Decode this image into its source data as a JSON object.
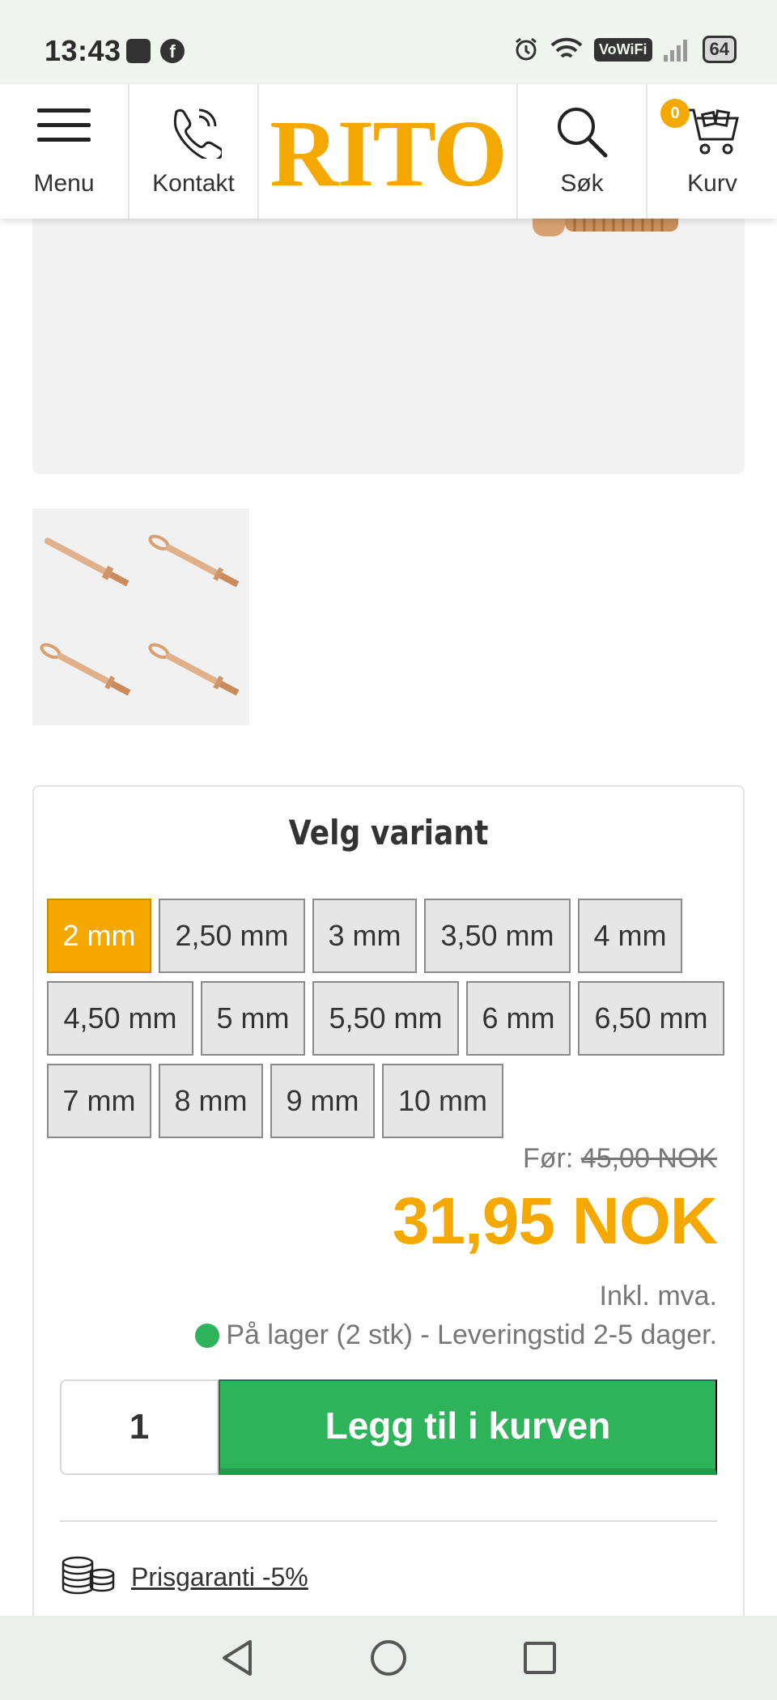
{
  "status_bar": {
    "time": "13:43",
    "vowifi": "VoWiFi",
    "battery": "64"
  },
  "header": {
    "menu_label": "Menu",
    "contact_label": "Kontakt",
    "logo_text": "RITO",
    "search_label": "Søk",
    "cart_label": "Kurv",
    "cart_count": "0"
  },
  "variant": {
    "title": "Velg variant",
    "options": [
      "2 mm",
      "2,50 mm",
      "3 mm",
      "3,50 mm",
      "4 mm",
      "4,50 mm",
      "5 mm",
      "5,50 mm",
      "6 mm",
      "6,50 mm",
      "7 mm",
      "8 mm",
      "9 mm",
      "10 mm"
    ],
    "selected": "2 mm"
  },
  "price": {
    "before_label": "Før:",
    "before_value": "45,00 NOK",
    "current": "31,95 NOK",
    "vat_note": "Inkl. mva.",
    "stock_text": "På lager (2 stk) - Leveringstid 2-5 dager."
  },
  "cart": {
    "quantity": "1",
    "add_label": "Legg til i kurven"
  },
  "guarantee": {
    "link_text": "Prisgaranti -5%"
  },
  "colors": {
    "brand": "#f5a800",
    "add_button": "#2fb35a",
    "stock_dot": "#2fb35a"
  }
}
